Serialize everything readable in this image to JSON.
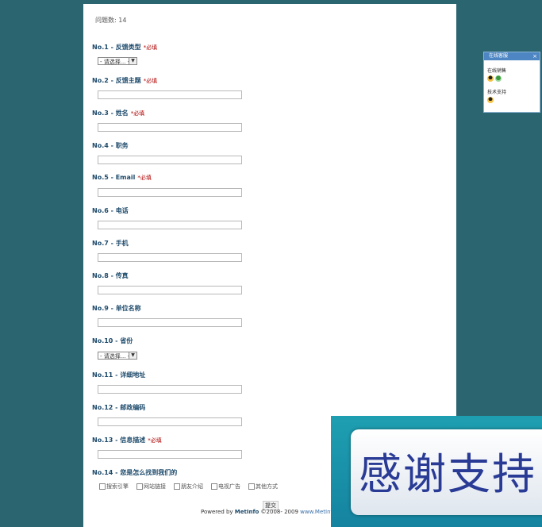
{
  "form": {
    "count_text": "问题数: 14",
    "questions": [
      {
        "label": "No.1 - 反馈类型",
        "required": "*必填",
        "type": "select",
        "value": "- 请选择... -"
      },
      {
        "label": "No.2 - 反馈主题",
        "required": "*必填",
        "type": "text"
      },
      {
        "label": "No.3 - 姓名",
        "required": "*必填",
        "type": "text"
      },
      {
        "label": "No.4 - 职务",
        "required": "",
        "type": "text"
      },
      {
        "label": "No.5 - Email",
        "required": "*必填",
        "type": "text"
      },
      {
        "label": "No.6 - 电话",
        "required": "",
        "type": "text"
      },
      {
        "label": "No.7 - 手机",
        "required": "",
        "type": "text"
      },
      {
        "label": "No.8 - 传真",
        "required": "",
        "type": "text"
      },
      {
        "label": "No.9 - 单位名称",
        "required": "",
        "type": "text"
      },
      {
        "label": "No.10 - 省份",
        "required": "",
        "type": "select",
        "value": "- 请选择... -"
      },
      {
        "label": "No.11 - 详细地址",
        "required": "",
        "type": "text"
      },
      {
        "label": "No.12 - 邮政编码",
        "required": "",
        "type": "text"
      },
      {
        "label": "No.13 - 信息描述",
        "required": "*必填",
        "type": "text"
      },
      {
        "label": "No.14 - 您是怎么找到我们的",
        "required": "",
        "type": "checkboxes"
      }
    ],
    "q14_options": [
      "搜索引擎",
      "网站链接",
      "朋友介绍",
      "电视广告",
      "其他方式"
    ],
    "submit_label": "提交",
    "footer": {
      "prefix": "Powered by ",
      "brand": "MetInfo",
      "years": " ©2008- 2009 ",
      "site": "www.MetInfo"
    }
  },
  "sidebar": {
    "title": "在线客服",
    "close": "×",
    "sections": [
      "在线销售",
      "技术支持"
    ]
  },
  "banner": {
    "text": "感谢支持"
  },
  "colors": {
    "background": "#2b6570",
    "label": "#1d4a6b",
    "required": "#b00000",
    "banner": "#2a3b96"
  }
}
